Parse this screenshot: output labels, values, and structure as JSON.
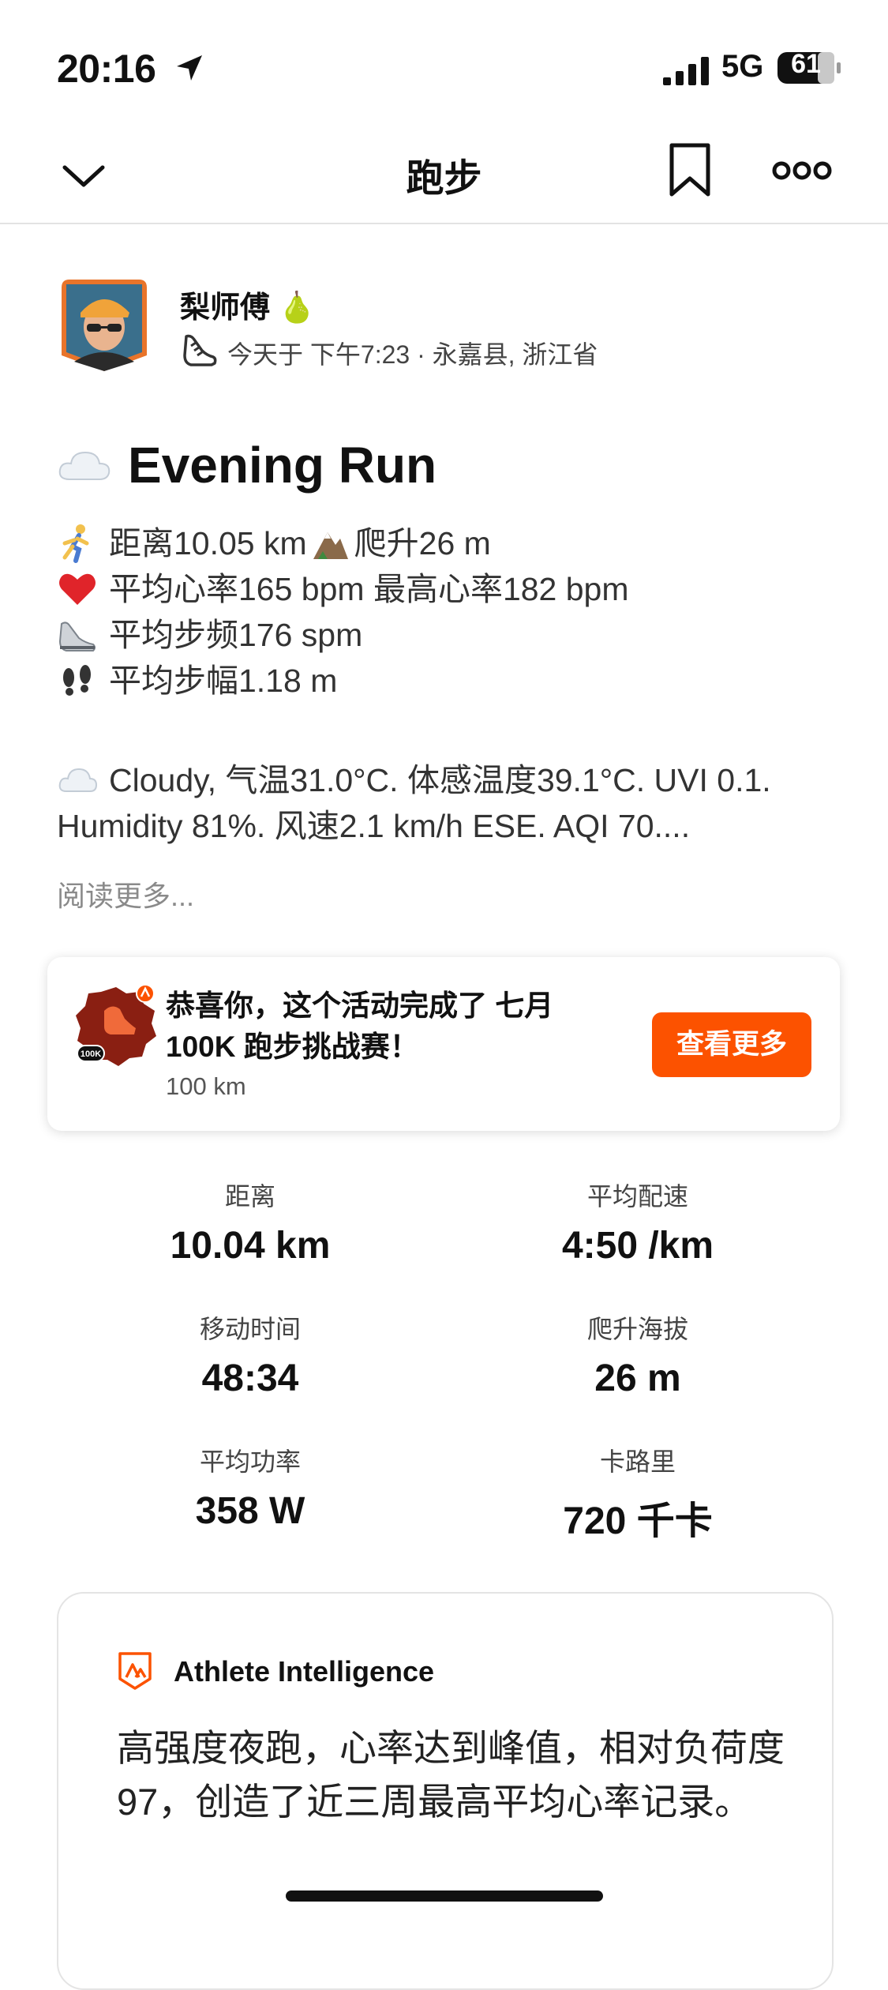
{
  "status_bar": {
    "time": "20:16",
    "network": "5G",
    "battery": "61"
  },
  "nav": {
    "title": "跑步"
  },
  "athlete": {
    "name": "梨师傅 🍐",
    "meta": "今天于 下午7:23 · 永嘉县, 浙江省"
  },
  "activity": {
    "title": "Evening Run",
    "lines": [
      {
        "icon": "runner-icon",
        "text": "距离10.05 km",
        "icon2": "mountain-icon",
        "text2": "爬升26 m"
      },
      {
        "icon": "heart-icon",
        "text": "平均心率165 bpm 最高心率182 bpm"
      },
      {
        "icon": "sneaker-icon",
        "text": "平均步频176 spm"
      },
      {
        "icon": "footprints-icon",
        "text": "平均步幅1.18 m"
      }
    ],
    "weather_line1": "Cloudy, 气温31.0°C. 体感温度39.1°C. UVI 0.1.",
    "weather_line2": "Humidity 81%. 风速2.1 km/h ESE. AQI 70....",
    "read_more": "阅读更多..."
  },
  "challenge": {
    "badge_text": "100K",
    "title": "恭喜你，这个活动完成了 七月 100K 跑步挑战赛！",
    "subtitle": "100 km",
    "button": "查看更多"
  },
  "stats": [
    {
      "label": "距离",
      "value": "10.04 km"
    },
    {
      "label": "平均配速",
      "value": "4:50 /km"
    },
    {
      "label": "移动时间",
      "value": "48:34"
    },
    {
      "label": "爬升海拔",
      "value": "26 m"
    },
    {
      "label": "平均功率",
      "value": "358 W"
    },
    {
      "label": "卡路里",
      "value": "720 千卡"
    }
  ],
  "ai": {
    "title": "Athlete Intelligence",
    "body": "高强度夜跑，心率达到峰值，相对负荷度97，创造了近三周最高平均心率记录。"
  },
  "colors": {
    "accent": "#fc5200"
  }
}
